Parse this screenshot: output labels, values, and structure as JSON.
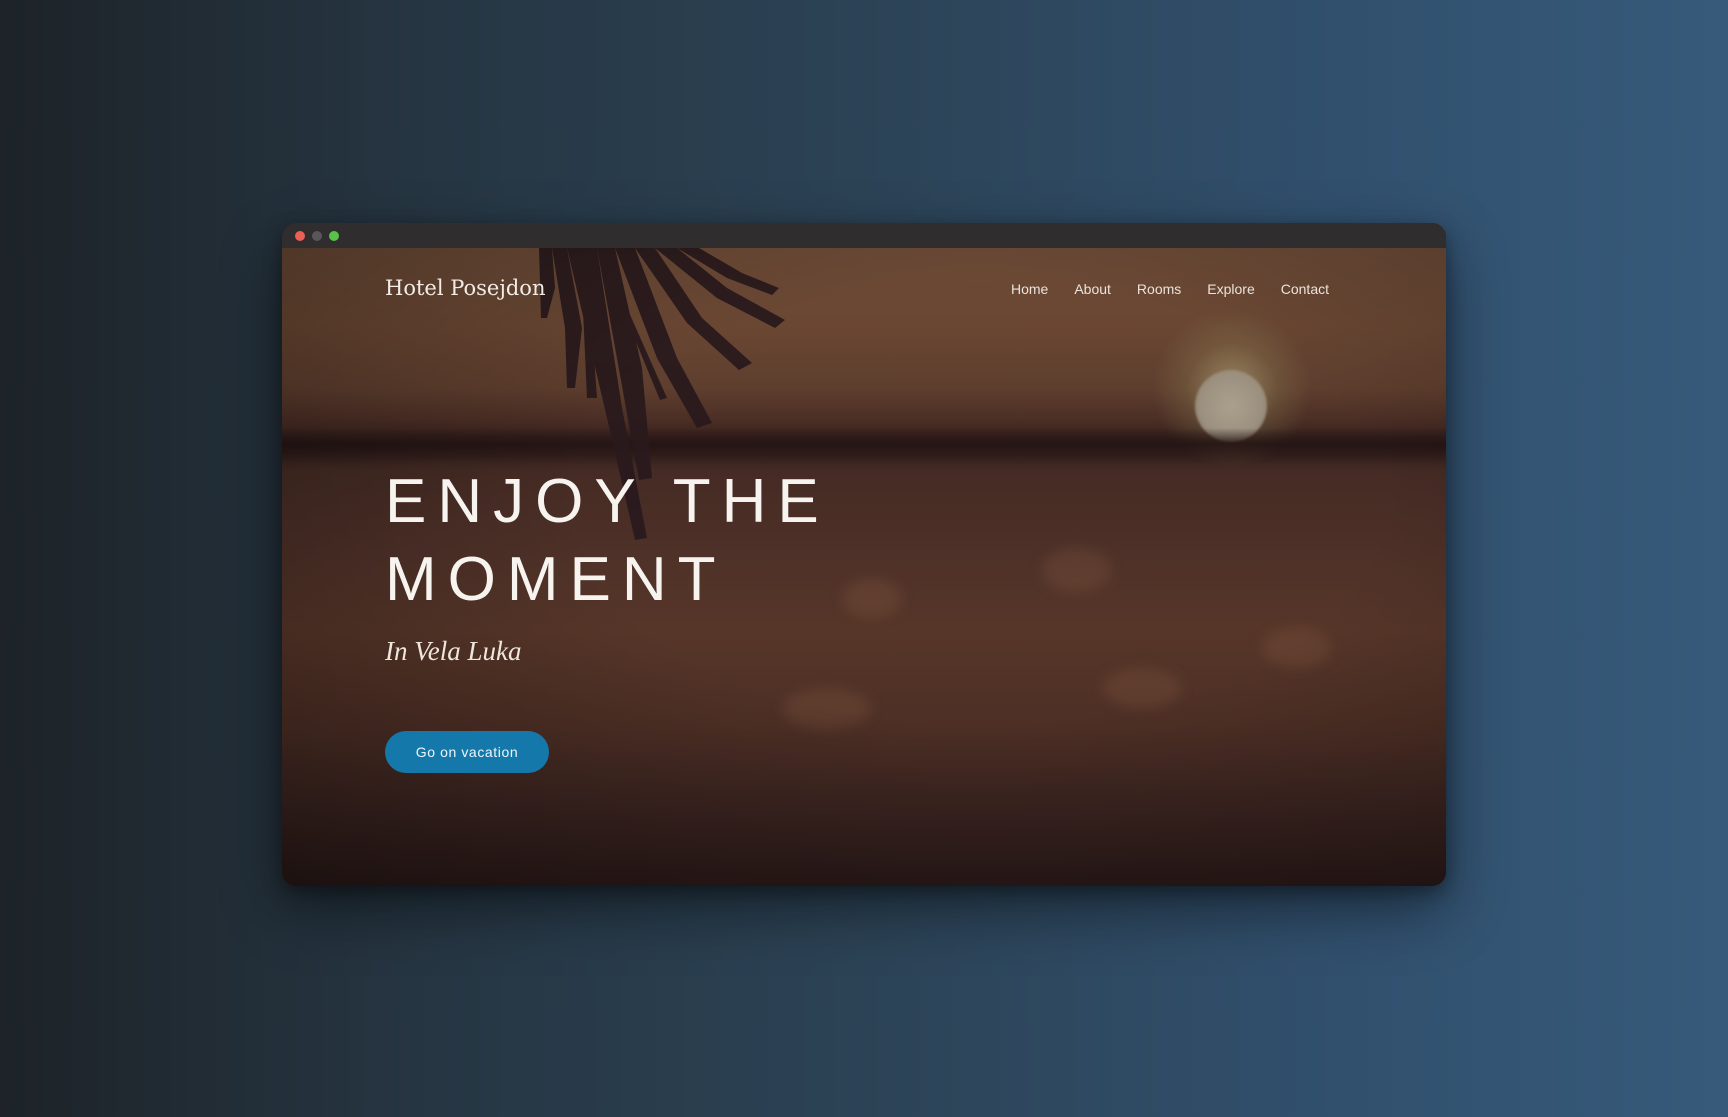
{
  "window": {
    "controls": [
      {
        "name": "close",
        "color": "#ec5f55"
      },
      {
        "name": "minimize",
        "color": "#57575a"
      },
      {
        "name": "maximize",
        "color": "#5ac24a"
      }
    ]
  },
  "site": {
    "brand": "Hotel Posejdon"
  },
  "nav": {
    "items": [
      "Home",
      "About",
      "Rooms",
      "Explore",
      "Contact"
    ]
  },
  "hero": {
    "headline_line1": "ENJOY THE",
    "headline_line2": "MOMENT",
    "subtitle": "In Vela Luka",
    "cta_label": "Go on vacation",
    "cta_color": "#1578ab"
  }
}
